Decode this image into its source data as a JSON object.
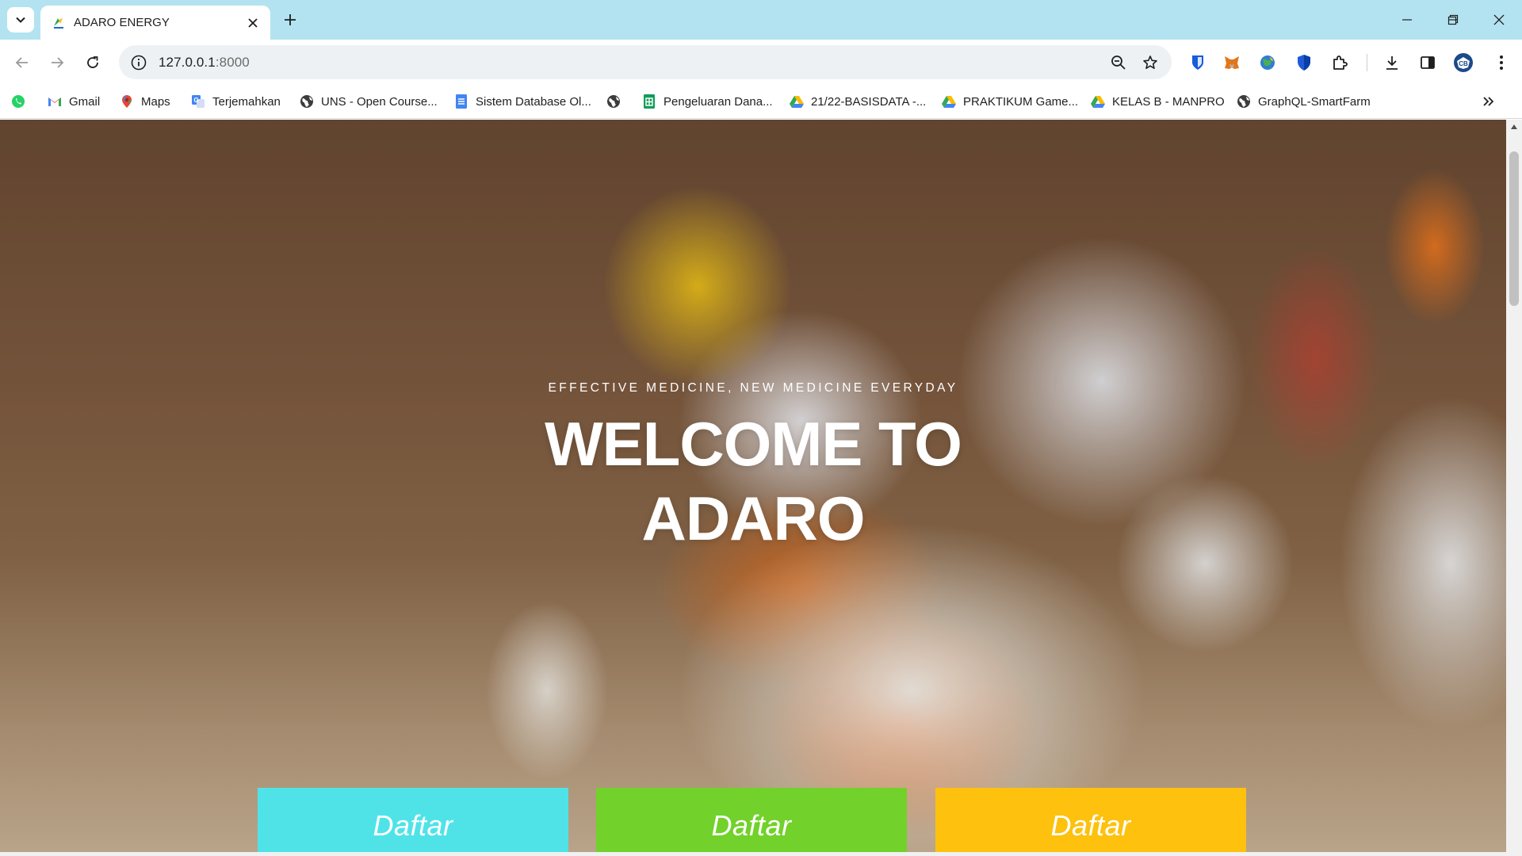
{
  "browser": {
    "tab": {
      "title": "ADARO ENERGY",
      "favicon": "adaro-logo-icon"
    },
    "address_bar": {
      "host": "127.0.0.1",
      "port": ":8000"
    },
    "bookmarks": [
      {
        "label": "",
        "icon": "whatsapp-icon"
      },
      {
        "label": "Gmail",
        "icon": "gmail-icon"
      },
      {
        "label": "Maps",
        "icon": "maps-icon"
      },
      {
        "label": "Terjemahkan",
        "icon": "translate-icon"
      },
      {
        "label": "UNS - Open Course...",
        "icon": "globe-icon"
      },
      {
        "label": "Sistem Database Ol...",
        "icon": "docs-icon"
      },
      {
        "label": "",
        "icon": "globe-icon"
      },
      {
        "label": "Pengeluaran Dana...",
        "icon": "sheets-icon"
      },
      {
        "label": "21/22-BASISDATA -...",
        "icon": "drive-icon"
      },
      {
        "label": "PRAKTIKUM Game...",
        "icon": "drive-icon"
      },
      {
        "label": "KELAS B - MANPRO",
        "icon": "drive-icon"
      },
      {
        "label": "GraphQL-SmartFarm",
        "icon": "globe-icon"
      }
    ]
  },
  "hero": {
    "eyebrow": "EFFECTIVE MEDICINE, NEW MEDICINE EVERYDAY",
    "headline_line1": "WELCOME TO",
    "headline_line2": "ADARO",
    "buttons": [
      {
        "label": "Daftar",
        "color": "#4fe3e8"
      },
      {
        "label": "Daftar",
        "color": "#72d12a"
      },
      {
        "label": "Daftar",
        "color": "#fdc10e"
      }
    ]
  },
  "colors": {
    "tabstrip": "#b3e3f0",
    "omnibox": "#eef1f3"
  }
}
